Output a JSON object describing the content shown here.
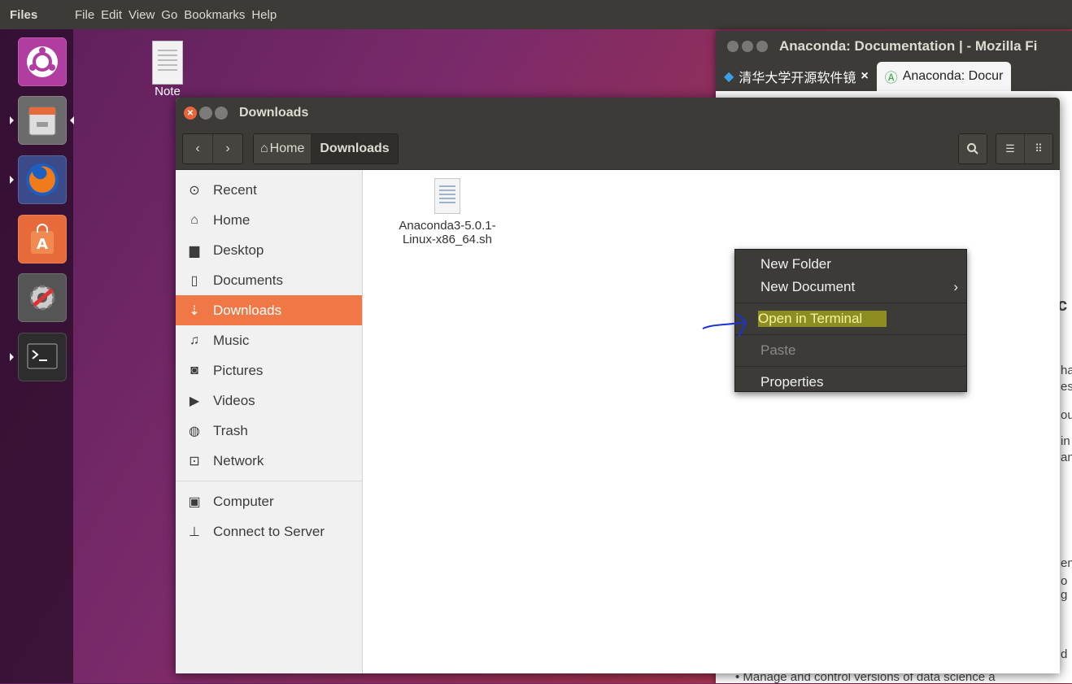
{
  "top_panel": {
    "app_name": "Files",
    "menu": [
      "File",
      "Edit",
      "View",
      "Go",
      "Bookmarks",
      "Help"
    ]
  },
  "desktop": {
    "icon_label": "Note"
  },
  "firefox": {
    "title": "Anaconda: Documentation | - Mozilla Fi",
    "tabs": [
      {
        "label": "清华大学开源软件镜"
      },
      {
        "label": "Anaconda: Docur"
      }
    ],
    "fragments": [
      "c",
      "ha",
      "es",
      "ou",
      "in",
      "an",
      "en",
      "o g",
      "d"
    ],
    "bottom_text": "• Manage and control versions of data science a"
  },
  "files_window": {
    "title": "Downloads",
    "breadcrumb": {
      "home": "Home",
      "current": "Downloads"
    },
    "sidebar": [
      {
        "label": "Recent",
        "icon": "clock-icon",
        "glyph": "⊙"
      },
      {
        "label": "Home",
        "icon": "home-icon",
        "glyph": "⌂"
      },
      {
        "label": "Desktop",
        "icon": "folder-icon",
        "glyph": "▆"
      },
      {
        "label": "Documents",
        "icon": "document-icon",
        "glyph": "▯"
      },
      {
        "label": "Downloads",
        "icon": "download-icon",
        "glyph": "⇣"
      },
      {
        "label": "Music",
        "icon": "music-icon",
        "glyph": "♫"
      },
      {
        "label": "Pictures",
        "icon": "camera-icon",
        "glyph": "◙"
      },
      {
        "label": "Videos",
        "icon": "video-icon",
        "glyph": "▶"
      },
      {
        "label": "Trash",
        "icon": "trash-icon",
        "glyph": "◍"
      },
      {
        "label": "Network",
        "icon": "network-icon",
        "glyph": "⊡"
      },
      {
        "label": "Computer",
        "icon": "computer-icon",
        "glyph": "▣"
      },
      {
        "label": "Connect to Server",
        "icon": "server-icon",
        "glyph": "⊥"
      }
    ],
    "file": {
      "line1": "Anaconda3-5.0.1-",
      "line2": "Linux-x86_64.sh"
    }
  },
  "context_menu": {
    "items": [
      "New Folder",
      "New Document",
      "Open in Terminal",
      "Paste",
      "Properties"
    ]
  },
  "colors": {
    "accent": "#f07746",
    "panel": "#3c3b37",
    "highlight": "#d2d214"
  }
}
